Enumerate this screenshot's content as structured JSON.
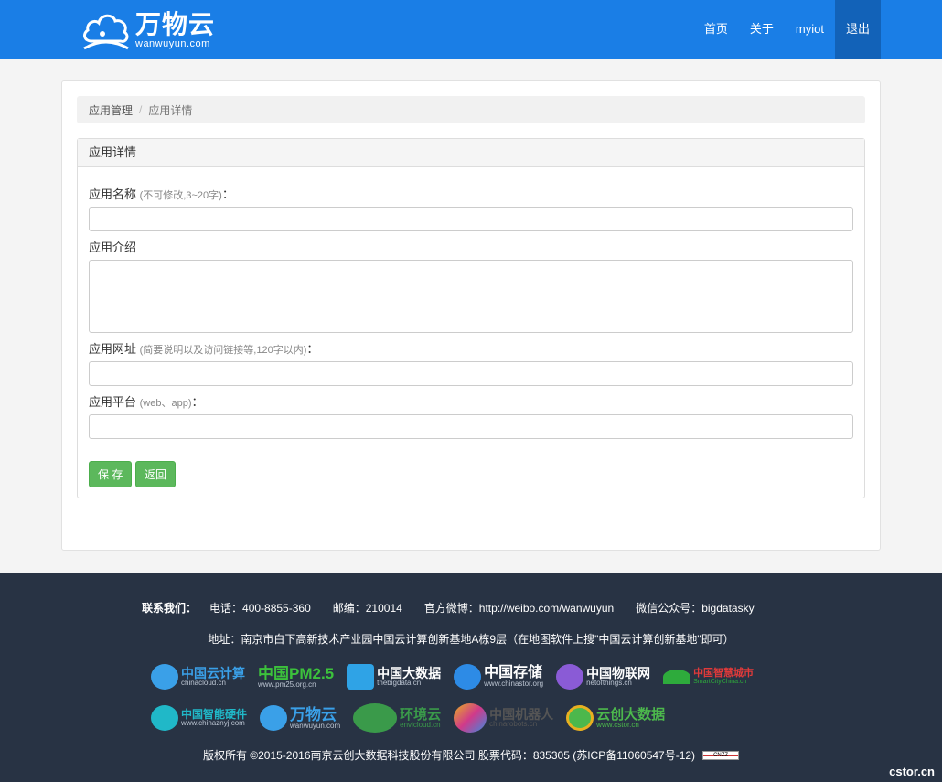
{
  "brand": {
    "title": "万物云",
    "subtitle": "wanwuyun.com"
  },
  "nav": {
    "items": [
      "首页",
      "关于",
      "myiot",
      "退出"
    ]
  },
  "breadcrumb": {
    "parent": "应用管理",
    "separator": "/",
    "current": "应用详情"
  },
  "panel": {
    "heading": "应用详情",
    "fields": {
      "name": {
        "label": "应用名称",
        "hint": "(不可修改,3~20字)",
        "suffix": "：",
        "value": ""
      },
      "intro": {
        "label": "应用介绍",
        "value": ""
      },
      "url": {
        "label": "应用网址",
        "hint": "(简要说明以及访问链接等,120字以内)",
        "suffix": "：",
        "value": ""
      },
      "platform": {
        "label": "应用平台",
        "hint": "(web、app)",
        "suffix": "：",
        "value": ""
      }
    },
    "buttons": {
      "save": "保 存",
      "back": "返回"
    }
  },
  "footer": {
    "contact_label": "联系我们：",
    "phone": "电话：400-8855-360",
    "postcode": "邮编：210014",
    "weibo": "官方微博：http://weibo.com/wanwuyun",
    "wechat": "微信公众号：bigdatasky",
    "address": "地址：南京市白下高新技术产业园中国云计算创新基地A栋9层（在地图软件上搜\"中国云计算创新基地\"即可）",
    "logos_row1": [
      {
        "title": "中国云计算",
        "sub": "chinacloud.cn",
        "color": "#3aa0e8"
      },
      {
        "title": "中国PM2.5",
        "sub": "www.pm25.org.cn",
        "color": "#3cc13c"
      },
      {
        "title": "中国大数据",
        "sub": "thebigdata.cn",
        "color": "#2fa3e6"
      },
      {
        "title": "中国存储",
        "sub": "www.chinastor.org",
        "color": "#2d8be6"
      },
      {
        "title": "中国物联网",
        "sub": "netofthings.cn",
        "color": "#8a5bd6"
      },
      {
        "title": "中国智慧城市",
        "sub": "SmartCityChina.cn",
        "color": "#2eab3c"
      }
    ],
    "logos_row2": [
      {
        "title": "中国智能硬件",
        "sub": "www.chinaznyj.com",
        "color": "#20b8c8"
      },
      {
        "title": "万物云",
        "sub": "wanwuyun.com",
        "color": "#3aa0e8"
      },
      {
        "title": "环境云",
        "sub": "envicloud.cn",
        "color": "#3a9a4a"
      },
      {
        "title": "中国机器人",
        "sub": "chinarobots.cn",
        "color": "#e8b020"
      },
      {
        "title": "云创大数据",
        "sub": "www.cstor.cn",
        "color": "#4cb84c"
      }
    ],
    "copyright": "版权所有 ©2015-2016南京云创大数据科技股份有限公司 股票代码：835305 (苏ICP备11060547号-12)",
    "badge": "CNZZ",
    "watermark": "cstor.cn"
  }
}
